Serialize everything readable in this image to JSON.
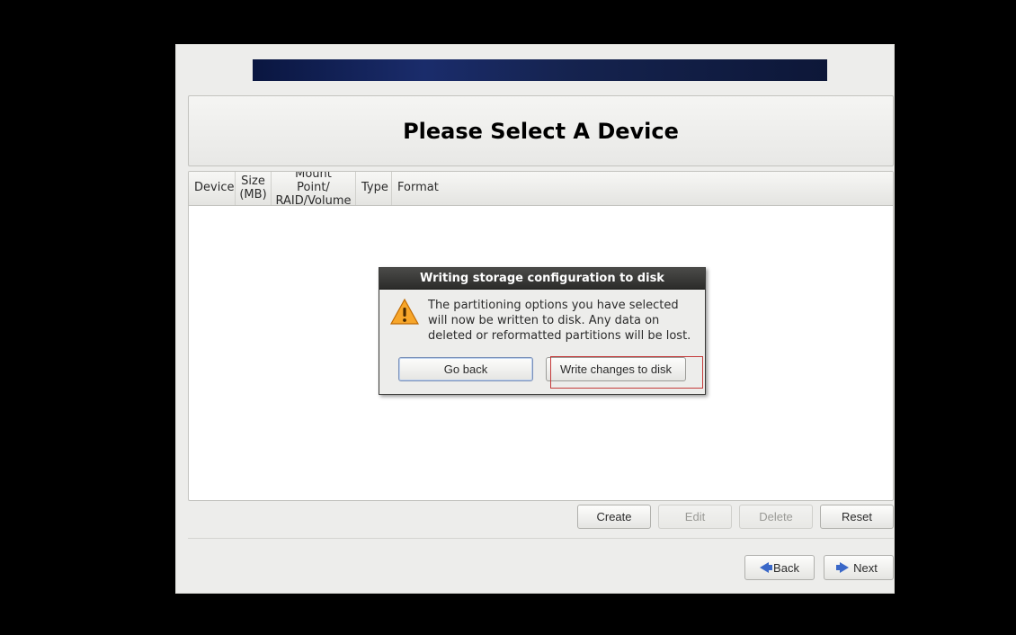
{
  "page": {
    "title": "Please Select A Device"
  },
  "table": {
    "headers": {
      "device": "Device",
      "size1": "Size",
      "size2": "(MB)",
      "mount1": "Mount Point/",
      "mount2": "RAID/Volume",
      "type": "Type",
      "format": "Format"
    }
  },
  "actions": {
    "create": "Create",
    "edit": "Edit",
    "delete": "Delete",
    "reset": "Reset"
  },
  "nav": {
    "back": "Back",
    "next": "Next"
  },
  "dialog": {
    "title": "Writing storage configuration to disk",
    "message": "The partitioning options you have selected will now be written to disk.  Any data on deleted or reformatted partitions will be lost.",
    "go_back": "Go back",
    "write": "Write changes to disk"
  }
}
